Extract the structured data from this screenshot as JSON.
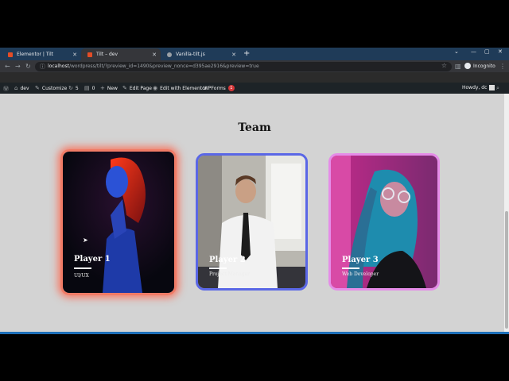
{
  "browser": {
    "tabs": [
      {
        "label": "Elementor | Tilt",
        "color": "#e44d26"
      },
      {
        "label": "Tilt – dev",
        "color": "#e44d26"
      },
      {
        "label": "Vanilla-tilt.js",
        "color": "#9aa0a6"
      }
    ],
    "new_tab": "+",
    "url_host": "localhost",
    "url_path": "/wordpress/tilt/?preview_id=1490&preview_nonce=d395ae2916&preview=true",
    "profile": "Incognito"
  },
  "wp_admin": {
    "site": "dev",
    "customize": "Customize",
    "updates_count": "5",
    "comments_count": "0",
    "new": "New",
    "edit_page": "Edit Page",
    "edit_elementor": "Edit with Elementor",
    "wpforms": "WPForms",
    "wpforms_badge": "1",
    "howdy": "Howdy, dc"
  },
  "page": {
    "title": "Team",
    "cards": [
      {
        "name": "Player 1",
        "role": "UI/UX",
        "border": "#f07b66"
      },
      {
        "name": "Player 2",
        "role": "Project Manager",
        "border": "#5a67e6"
      },
      {
        "name": "Player 3",
        "role": "Web Developer",
        "border": "#e58ce8"
      }
    ]
  }
}
